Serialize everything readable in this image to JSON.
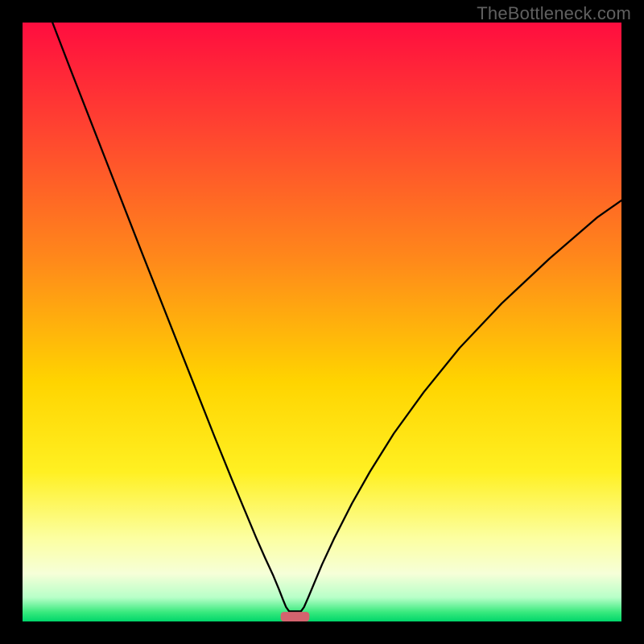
{
  "watermark": "TheBottleneck.com",
  "chart_data": {
    "type": "line",
    "title": "",
    "xlabel": "",
    "ylabel": "",
    "xlim": [
      0,
      100
    ],
    "ylim": [
      0,
      100
    ],
    "grid": false,
    "legend": false,
    "background_gradient": {
      "stops": [
        {
          "offset": 0.0,
          "color": "#ff0d3f"
        },
        {
          "offset": 0.18,
          "color": "#ff4430"
        },
        {
          "offset": 0.4,
          "color": "#ff8a1a"
        },
        {
          "offset": 0.6,
          "color": "#ffd400"
        },
        {
          "offset": 0.75,
          "color": "#fff022"
        },
        {
          "offset": 0.86,
          "color": "#fcffa0"
        },
        {
          "offset": 0.92,
          "color": "#f6ffd8"
        },
        {
          "offset": 0.96,
          "color": "#b7ffc8"
        },
        {
          "offset": 0.985,
          "color": "#36e97d"
        },
        {
          "offset": 1.0,
          "color": "#00d66a"
        }
      ]
    },
    "series": [
      {
        "name": "curve",
        "color": "#000000",
        "stroke_width": 2.3,
        "closed": false,
        "x": [
          5.0,
          8.0,
          11.0,
          14.0,
          17.0,
          20.0,
          23.0,
          26.0,
          29.0,
          32.0,
          35.0,
          37.0,
          39.0,
          40.5,
          41.8,
          42.8,
          43.5,
          44.0,
          44.5,
          46.5,
          47.0,
          47.7,
          48.7,
          50.0,
          52.0,
          55.0,
          58.0,
          62.0,
          67.0,
          73.0,
          80.0,
          88.0,
          96.0,
          100.0
        ],
        "y": [
          100.0,
          92.2,
          84.5,
          76.8,
          69.1,
          61.4,
          53.8,
          46.2,
          38.6,
          31.0,
          23.6,
          18.8,
          14.0,
          10.6,
          7.8,
          5.4,
          3.6,
          2.4,
          1.7,
          1.7,
          2.4,
          4.0,
          6.4,
          9.5,
          13.8,
          19.7,
          25.0,
          31.4,
          38.3,
          45.7,
          53.1,
          60.6,
          67.5,
          70.3
        ]
      }
    ],
    "marker": {
      "name": "min-marker",
      "color": "#d4636e",
      "x_center": 45.5,
      "width": 4.8,
      "height_pct": 1.6,
      "corner_radius": 4
    }
  }
}
